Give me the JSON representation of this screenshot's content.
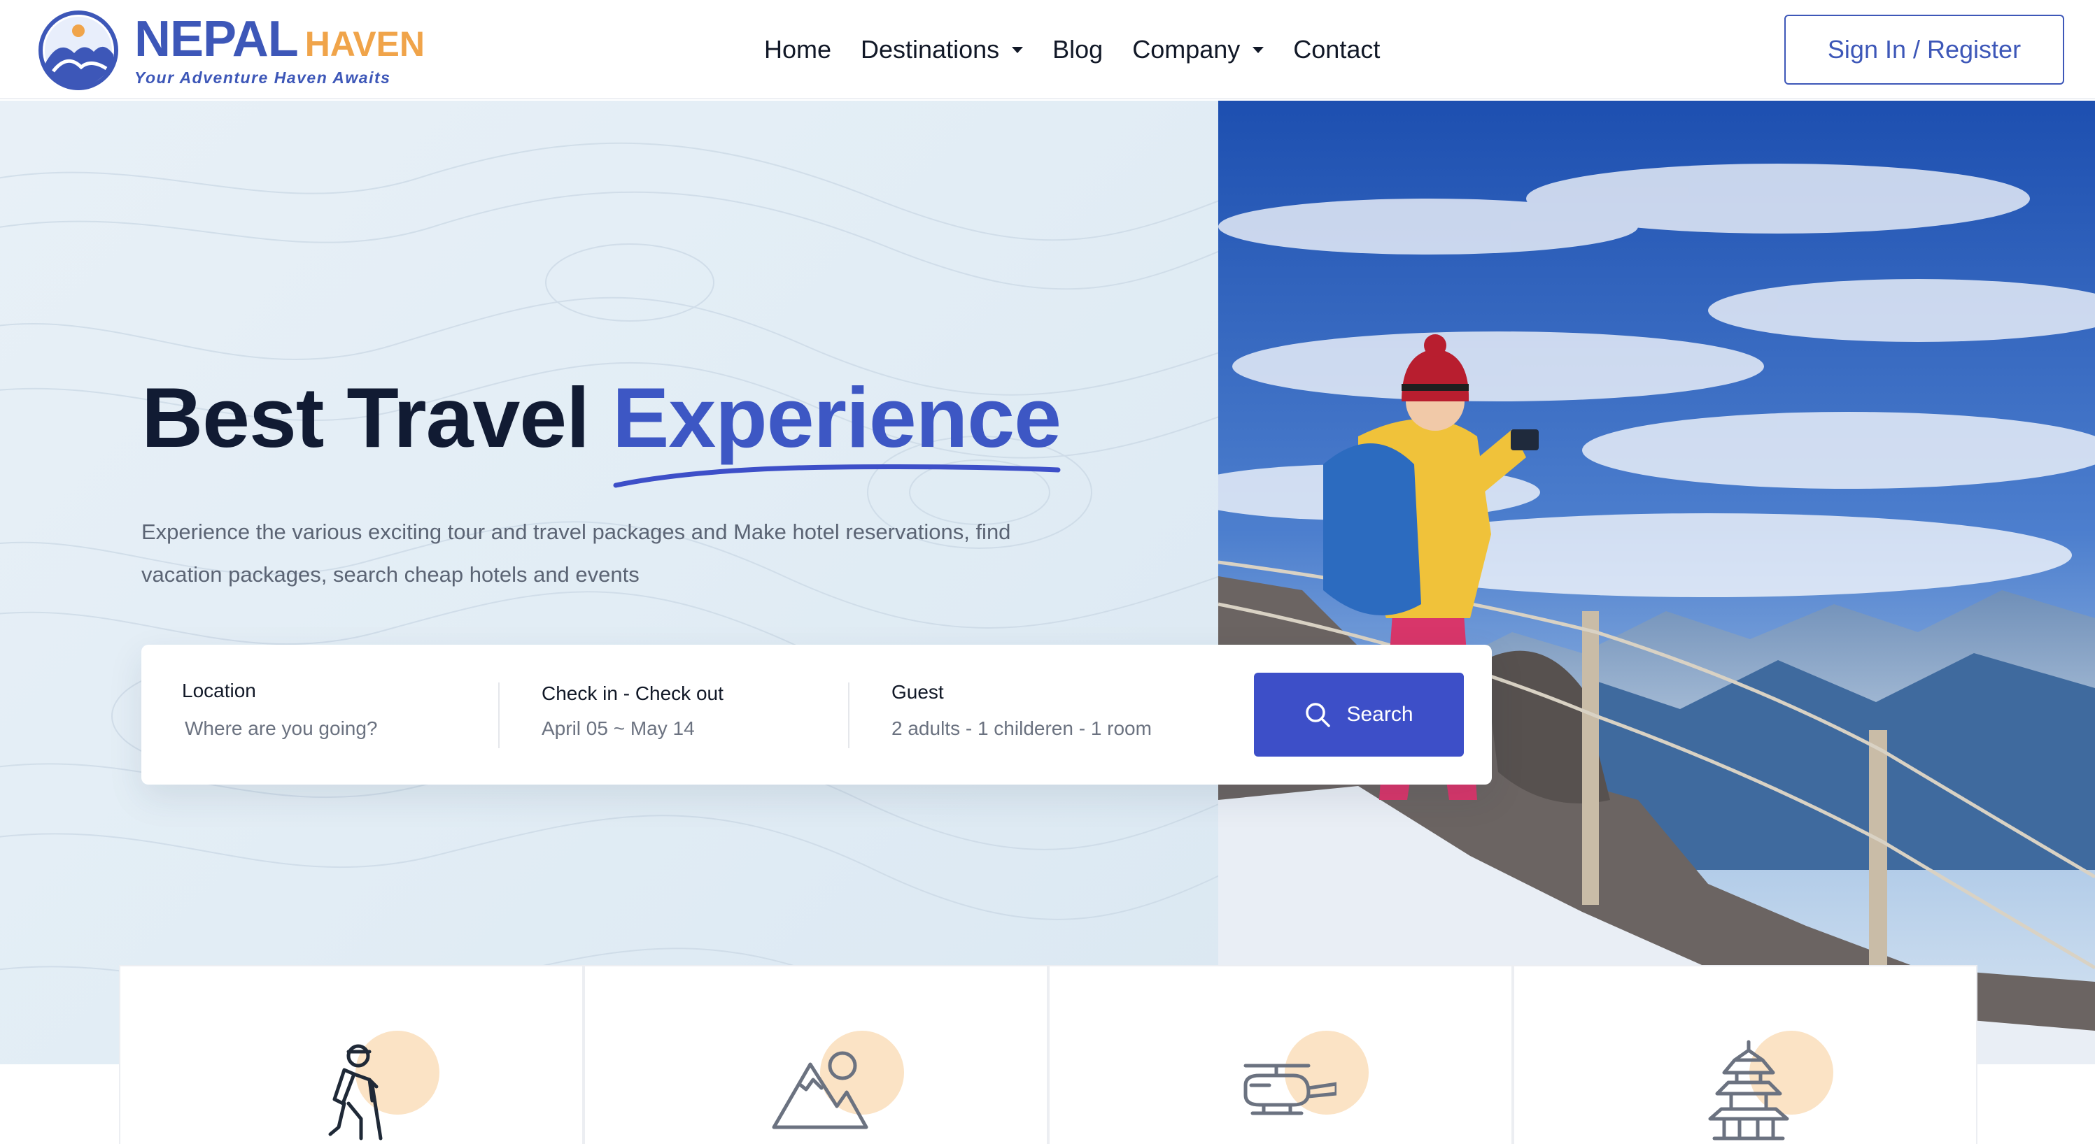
{
  "brand": {
    "name_primary": "NEPAL",
    "name_secondary": "HAVEN",
    "tagline": "Your Adventure Haven Awaits",
    "primary_color": "#3d57b8",
    "accent_color": "#f0a44a"
  },
  "nav": {
    "items": [
      {
        "label": "Home",
        "dropdown": false
      },
      {
        "label": "Destinations",
        "dropdown": true
      },
      {
        "label": "Blog",
        "dropdown": false
      },
      {
        "label": "Company",
        "dropdown": true
      },
      {
        "label": "Contact",
        "dropdown": false
      }
    ],
    "signin_label": "Sign In / Register"
  },
  "hero": {
    "title_plain": "Best Travel",
    "title_accent": "Experience",
    "description": "Experience the various exciting tour and travel packages and Make hotel reservations, find vacation packages, search cheap hotels and events"
  },
  "search": {
    "location_label": "Location",
    "location_placeholder": "Where are you going?",
    "dates_label": "Check in - Check out",
    "dates_value": "April 05 ~ May 14",
    "guest_label": "Guest",
    "guest_value": "2 adults - 1 childeren - 1 room",
    "button_label": "Search",
    "button_color": "#3d4fc8"
  },
  "categories": [
    {
      "icon": "trekker-icon"
    },
    {
      "icon": "mountain-icon"
    },
    {
      "icon": "helicopter-icon"
    },
    {
      "icon": "pagoda-temple-icon"
    }
  ]
}
